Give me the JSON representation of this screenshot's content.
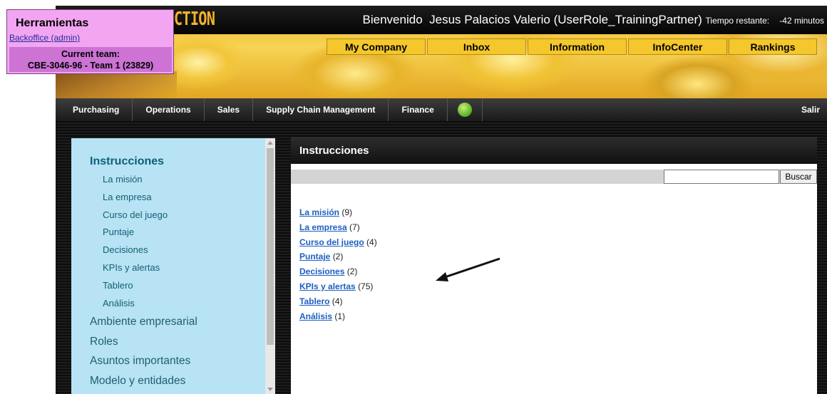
{
  "header": {
    "logo_text": "CTION",
    "welcome": "Bienvenido",
    "user": "Jesus Palacios Valerio (UserRole_TrainingPartner)",
    "time_label": "Tiempo restante:",
    "time_value": "-42 minutos"
  },
  "top_nav": [
    "My Company",
    "Inbox",
    "Information",
    "InfoCenter",
    "Rankings"
  ],
  "section_nav": {
    "items": [
      "Purchasing",
      "Operations",
      "Sales",
      "Supply Chain Management",
      "Finance"
    ],
    "status_color": "#63b92a",
    "logout": "Salir"
  },
  "toc": {
    "heading": "Instrucciones",
    "sub_items": [
      "La misión",
      "La empresa",
      "Curso del juego",
      "Puntaje",
      "Decisiones",
      "KPIs y alertas",
      "Tablero",
      "Análisis"
    ],
    "main_items": [
      "Ambiente empresarial",
      "Roles",
      "Asuntos importantes",
      "Modelo y entidades"
    ]
  },
  "content": {
    "title": "Instrucciones",
    "search_button": "Buscar",
    "search_value": "",
    "links": [
      {
        "label": "La misión",
        "count": "(9)"
      },
      {
        "label": "La empresa",
        "count": "(7)"
      },
      {
        "label": "Curso del juego",
        "count": "(4)"
      },
      {
        "label": "Puntaje",
        "count": "(2)"
      },
      {
        "label": "Decisiones",
        "count": "(2)"
      },
      {
        "label": "KPIs y alertas",
        "count": "(75)"
      },
      {
        "label": "Tablero",
        "count": "(4)"
      },
      {
        "label": "Análisis",
        "count": "(1)"
      }
    ]
  },
  "tools": {
    "title": "Herramientas",
    "backoffice": "Backoffice (admin)",
    "team_label": "Current team:",
    "team_value": "CBE-3046-96 - Team 1 (23829)"
  },
  "annotation": {
    "icon": "arrow-icon"
  }
}
